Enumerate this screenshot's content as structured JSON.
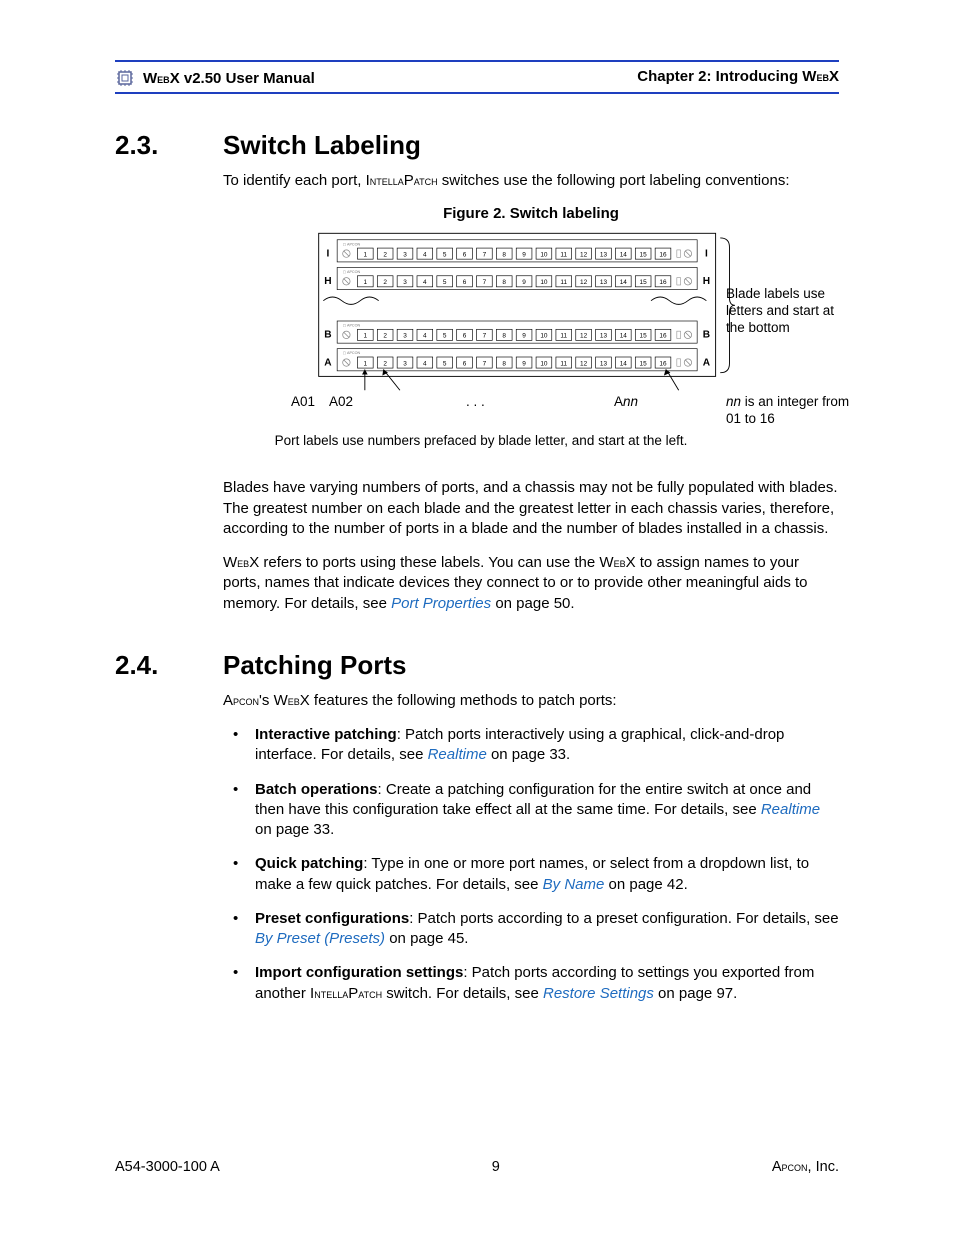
{
  "header": {
    "left_prefix": "W",
    "left_sc": "eb",
    "left_rest": "X v2.50 User Manual",
    "right_prefix": "Chapter 2: Introducing W",
    "right_sc": "eb",
    "right_suffix": "X"
  },
  "sec23": {
    "num": "2.3.",
    "title": "Switch Labeling",
    "intro_pre": "To identify each port, I",
    "intro_sc": "ntella",
    "intro_mid": "P",
    "intro_sc2": "atch",
    "intro_post": " switches use the following port labeling conventions:",
    "fig_caption": "Figure 2. Switch labeling",
    "figure": {
      "blades": [
        "I",
        "H",
        "B",
        "A"
      ],
      "ports": [
        "1",
        "2",
        "3",
        "4",
        "5",
        "6",
        "7",
        "8",
        "9",
        "10",
        "11",
        "12",
        "13",
        "14",
        "15",
        "16"
      ],
      "brand": "APCON",
      "port_labels": [
        "A01",
        "A02",
        ". . .",
        "A"
      ],
      "port_label_nn": "nn",
      "annot_right1": "Blade labels use letters and start at the bottom",
      "annot_right2_pre": "nn",
      "annot_right2_post": " is an integer from 01 to 16",
      "bottom_note": "Port labels use numbers prefaced by blade letter, and start at the left."
    },
    "p2": "Blades have varying numbers of ports, and a chassis may not be fully populated with blades. The greatest number on each blade and the greatest letter in each chassis varies, therefore, according to the number of ports in a blade and the number of blades installed in a chassis.",
    "p3_pre": "W",
    "p3_sc": "eb",
    "p3_mid": "X refers to ports using these labels. You can use the W",
    "p3_sc2": "eb",
    "p3_post": "X to assign names to your ports, names that indicate devices they connect to or to provide other meaningful aids to memory. For details, see ",
    "p3_link": "Port Properties",
    "p3_tail": " on page 50."
  },
  "sec24": {
    "num": "2.4.",
    "title": "Patching Ports",
    "intro_a": "A",
    "intro_a_sc": "pcon",
    "intro_mid": "'s W",
    "intro_mid_sc": "eb",
    "intro_post": "X features the following methods to patch ports:",
    "items": [
      {
        "bold": "Interactive patching",
        "text1": ": Patch ports interactively using a graphical, click-and-drop interface. For details, see ",
        "link": "Realtime",
        "text2": " on page 33."
      },
      {
        "bold": "Batch operations",
        "text1": ": Create a patching configuration for the entire switch at once and then have this configuration take effect all at the same time. For details, see ",
        "link": "Realtime",
        "text2": " on page 33."
      },
      {
        "bold": "Quick patching",
        "text1": ": Type in one or more port names, or select from a dropdown list, to make a few quick patches. For details, see ",
        "link": "By Name",
        "text2": " on page 42."
      },
      {
        "bold": "Preset configurations",
        "text1": ": Patch ports according to a preset configuration. For details, see ",
        "link": "By Preset (Presets)",
        "text2": " on page 45."
      },
      {
        "bold": "Import configuration settings",
        "text1": ": Patch ports according to settings you exported from another ",
        "sc1": "I",
        "sc1b": "ntella",
        "sc2": "P",
        "sc2b": "atch",
        "text1b": " switch. For details, see ",
        "link": "Restore Settings",
        "text2": " on page 97."
      }
    ]
  },
  "footer": {
    "left": "A54-3000-100 A",
    "center": "9",
    "right_a": "A",
    "right_sc": "pcon",
    "right_post": ", Inc."
  }
}
